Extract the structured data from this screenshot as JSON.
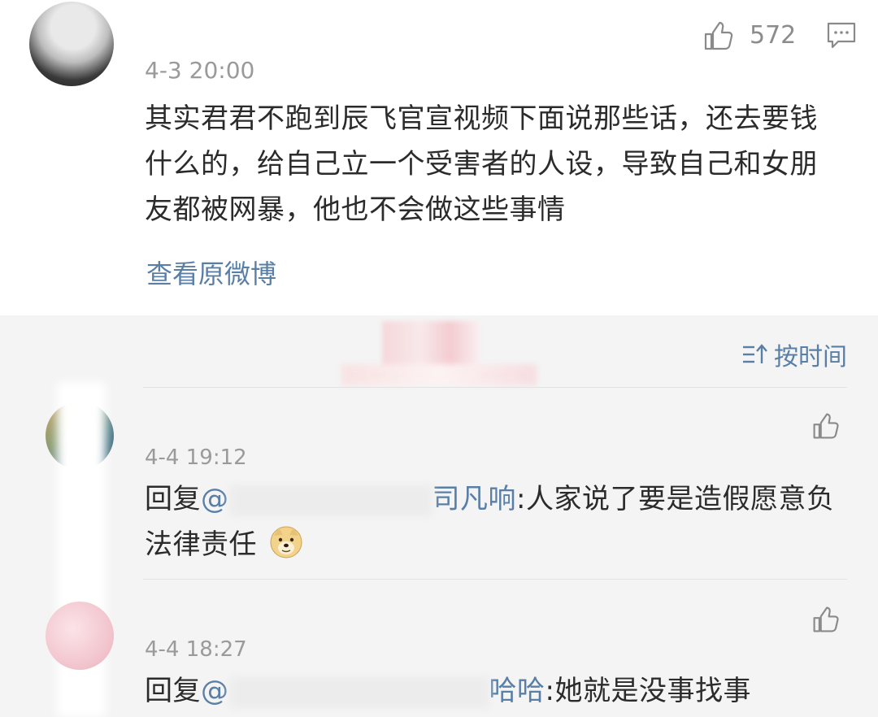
{
  "main_comment": {
    "like_count": "572",
    "time": "4-3 20:00",
    "text": "其实君君不跑到辰飞官宣视频下面说那些话，还去要钱什么的，给自己立一个受害者的人设，导致自己和女朋友都被网暴，他也不会做这些事情",
    "view_original": "查看原微博"
  },
  "sort": {
    "label": "按时间"
  },
  "replies": [
    {
      "time": "4-4 19:12",
      "reply_prefix": "回复",
      "at": "@",
      "mention_visible": "司凡响",
      "text": ":人家说了要是造假愿意负法律责任"
    },
    {
      "time": "4-4 18:27",
      "reply_prefix": "回复",
      "at": "@",
      "mention_visible": "哈哈",
      "text": ":她就是没事找事"
    }
  ],
  "icons": {
    "like": "thumbs-up-icon",
    "comment": "comment-icon",
    "sort": "sort-icon",
    "emoji": "doge-emoji-icon"
  },
  "colors": {
    "link": "#5a7fa6",
    "text": "#2b2b2b",
    "muted": "#9a9a9a",
    "background": "#f4f4f4"
  }
}
